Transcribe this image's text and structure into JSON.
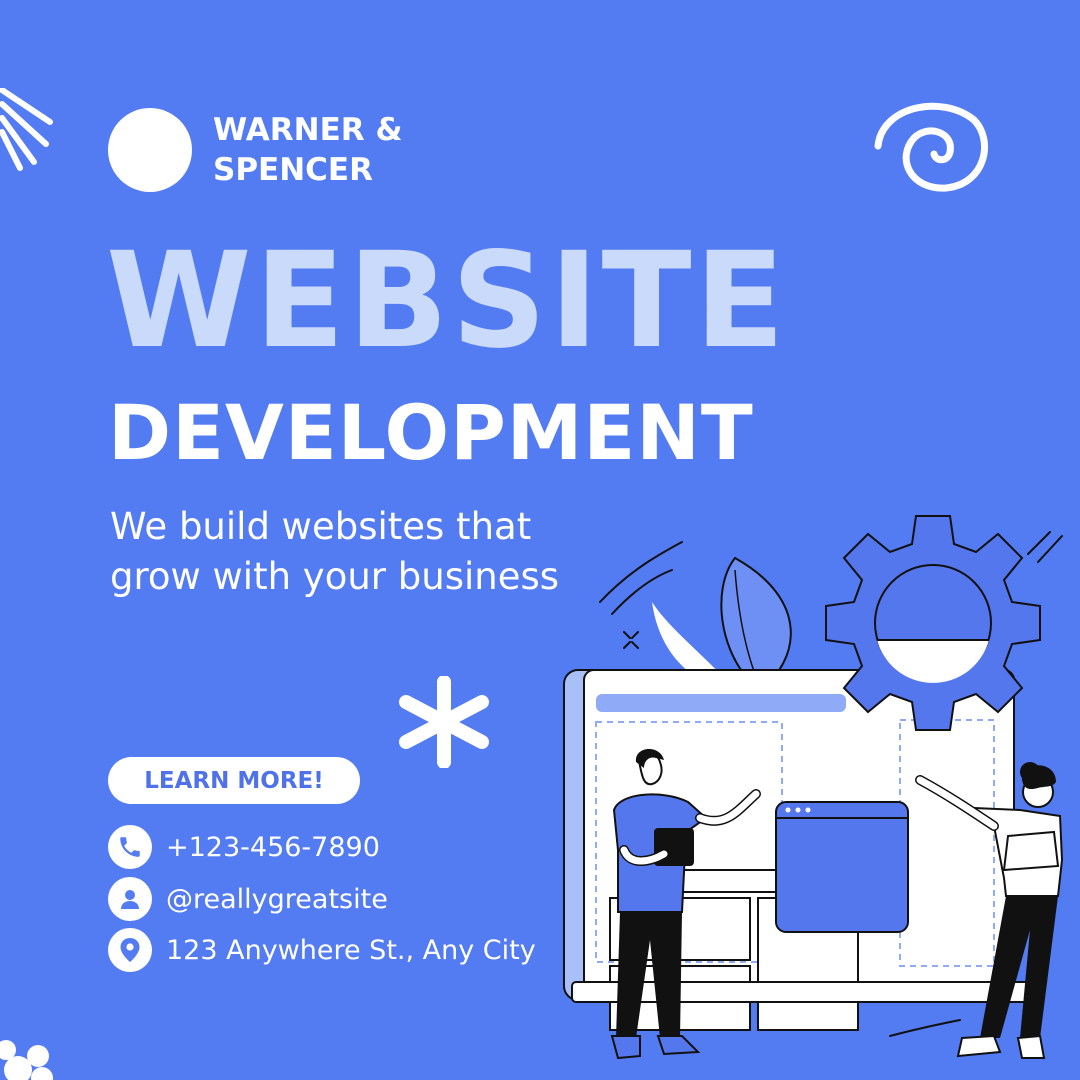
{
  "brand": {
    "line1": "WARNER &",
    "line2": "SPENCER"
  },
  "headline": {
    "primary": "WEBSITE",
    "secondary": "DEVELOPMENT"
  },
  "tagline": {
    "line1": "We build websites that",
    "line2": "grow with your business"
  },
  "cta": {
    "label": "LEARN MORE!"
  },
  "contacts": {
    "phone": "+123-456-7890",
    "social": "@reallygreatsite",
    "address": "123 Anywhere St., Any City"
  },
  "colors": {
    "background": "#537BF2",
    "headline_light": "#C9DAFB",
    "white": "#FFFFFF",
    "dark": "#111111",
    "accent_blue": "#5577EE"
  },
  "icons": [
    "phone-icon",
    "user-icon",
    "location-pin-icon",
    "gear-icon",
    "asterisk-icon",
    "spiral-icon",
    "sunburst-icon"
  ]
}
